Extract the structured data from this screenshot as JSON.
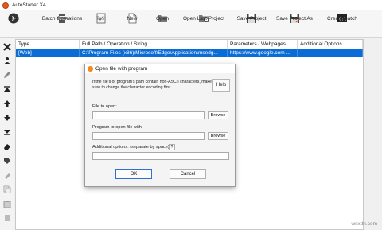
{
  "window": {
    "title": "AutoStarter X4"
  },
  "toolbar": {
    "start": "Start",
    "batch_operations": "Batch Operations",
    "test": "Test",
    "new": "New",
    "open": "Open",
    "open_last_project": "Open Last Project",
    "save_project": "Save Project",
    "save_project_as": "Save Project As",
    "create_batch": "Create Batch"
  },
  "grid": {
    "columns": [
      "Type",
      "Full Path / Operation / String",
      "Parameters / Webpages",
      "Additional Options"
    ],
    "rows": [
      {
        "type": "[Web]",
        "path": "C:\\Program Files (x86)\\Microsoft\\Edge\\Application\\msedg...",
        "params": "https://www.google.com ...",
        "options": ""
      }
    ]
  },
  "dialog": {
    "title": "Open file with program",
    "description": "If the file's or program's path contain non-ASCII characters, make sure to change the character encoding first.",
    "help": "Help",
    "file_label": "File to open:",
    "file_value": "|",
    "browse1": "Browse",
    "program_label": "Program to open file with:",
    "program_value": "",
    "browse2": "Browse",
    "options_label": "Additional options: (separate by space)",
    "qmark": "?",
    "options_value": "",
    "ok": "OK",
    "cancel": "Cancel"
  },
  "watermark": "wsxdn.com",
  "colors": {
    "selection": "#0a6cd6",
    "accent": "#e8561c"
  }
}
